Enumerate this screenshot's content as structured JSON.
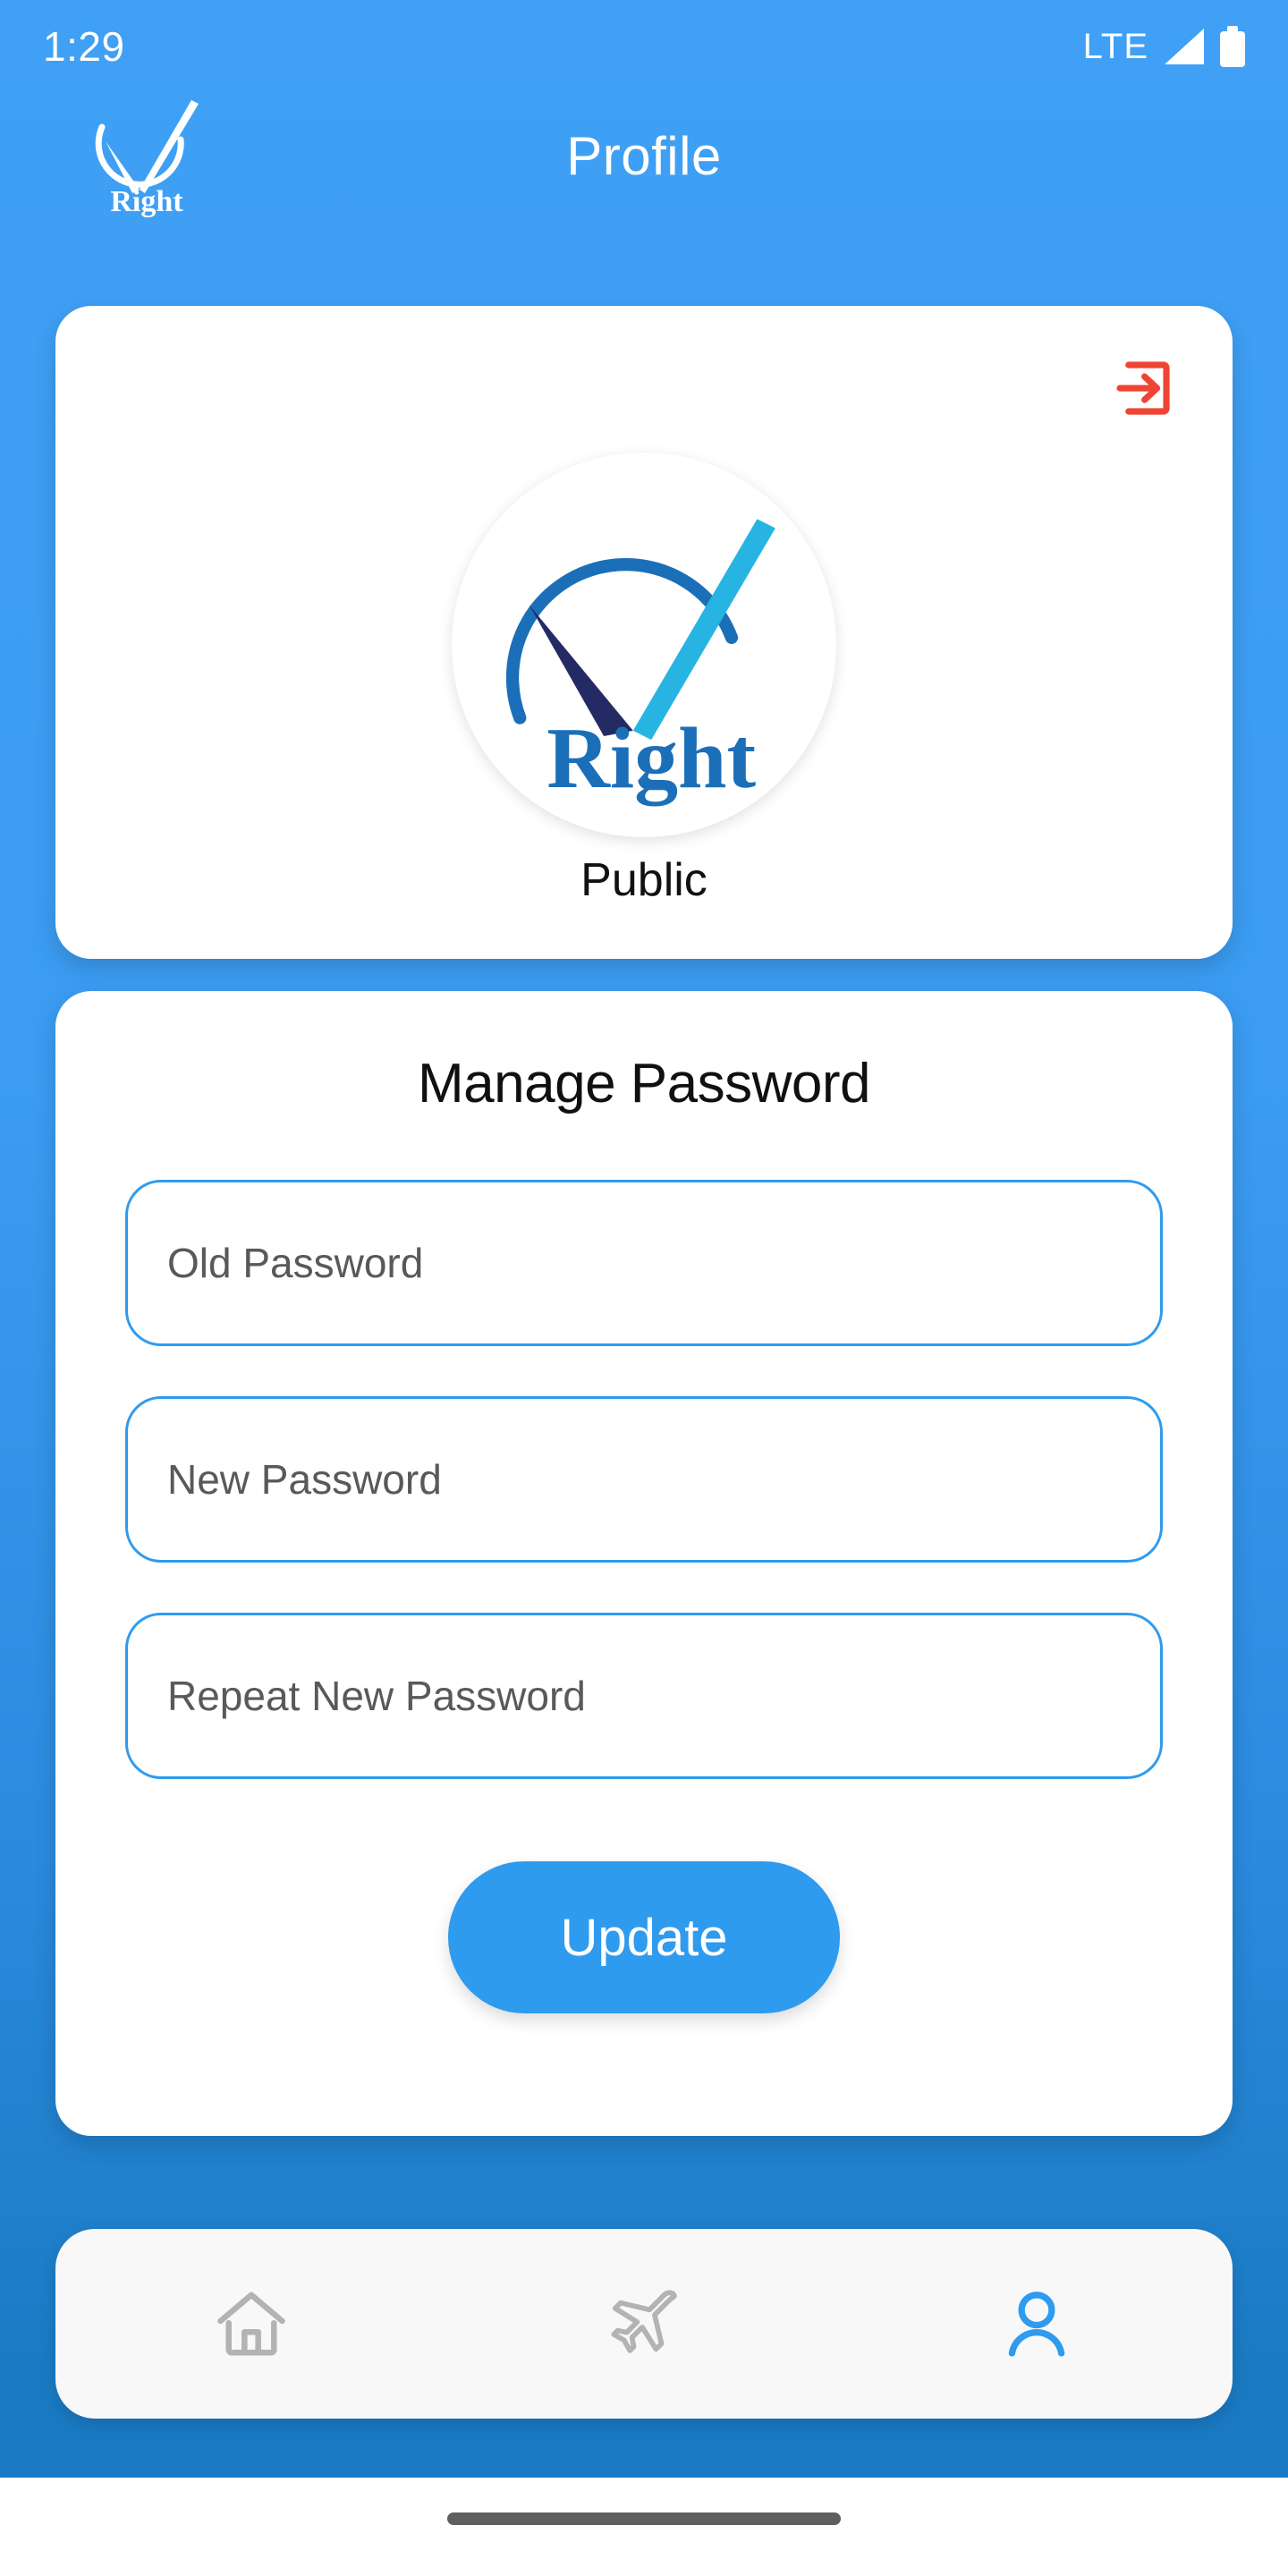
{
  "status_bar": {
    "time": "1:29",
    "network": "LTE",
    "signal_icon": "signal-bars-icon",
    "battery_icon": "battery-full-icon"
  },
  "header": {
    "title": "Profile",
    "logo_icon": "right-brand-check-logo",
    "logo_text": "Right"
  },
  "profile_card": {
    "logout_icon": "logout-icon",
    "avatar_icon": "right-brand-avatar-logo",
    "avatar_text": "Right",
    "name": "Public"
  },
  "password_card": {
    "title": "Manage Password",
    "fields": [
      {
        "name": "old-password",
        "placeholder": "Old Password",
        "value": ""
      },
      {
        "name": "new-password",
        "placeholder": "New Password",
        "value": ""
      },
      {
        "name": "repeat-new-password",
        "placeholder": "Repeat New Password",
        "value": ""
      }
    ],
    "update_label": "Update"
  },
  "bottom_nav": {
    "items": [
      {
        "name": "home",
        "icon": "home-icon",
        "active": false
      },
      {
        "name": "flights",
        "icon": "airplane-icon",
        "active": false
      },
      {
        "name": "profile",
        "icon": "person-icon",
        "active": true
      }
    ]
  },
  "colors": {
    "brand_blue": "#2e9bef",
    "background_top": "#3fa0f5",
    "background_bottom": "#1a7bc4",
    "logout_red": "#ef4433",
    "nav_inactive": "#b3b3b3",
    "nav_active": "#2e9bef",
    "logo_dark_navy": "#242a63",
    "logo_cyan": "#27b4e3",
    "logo_blue": "#1b6fb8"
  }
}
